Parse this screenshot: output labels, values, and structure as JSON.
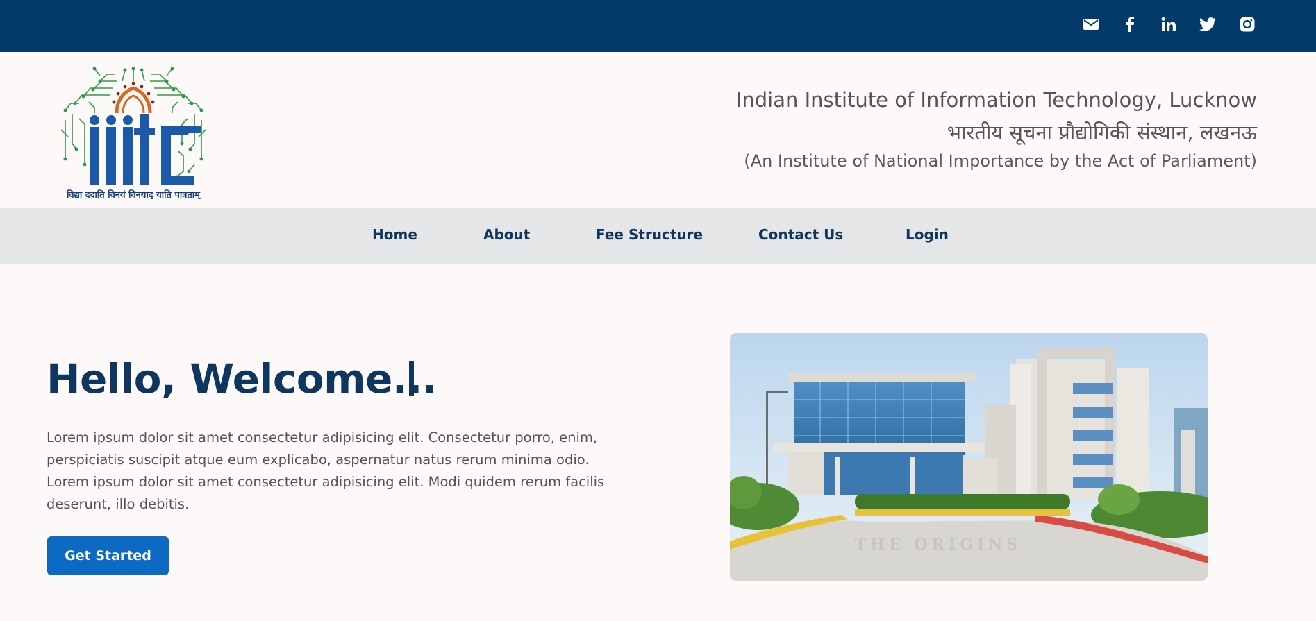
{
  "social_icons": [
    "mail-icon",
    "facebook-icon",
    "linkedin-icon",
    "twitter-icon",
    "instagram-icon"
  ],
  "header": {
    "logo_text": "iiitL",
    "logo_motto": "विद्या ददाति विनयं विनयाद् याति पात्रताम्",
    "title_en": "Indian Institute of Information Technology, Lucknow",
    "title_hi": "भारतीय सूचना प्रौद्योगिकी संस्थान, लखनऊ",
    "subtitle": "(An Institute of National Importance by the Act of Parliament)"
  },
  "nav": {
    "items": [
      "Home",
      "About",
      "Fee Structure",
      "Contact Us",
      "Login"
    ]
  },
  "hero": {
    "title": "Hello, Welcome...",
    "lines": [
      "Lorem ipsum dolor sit amet consectetur adipisicing elit. Consectetur porro, enim,",
      "perspiciatis suscipit atque eum explicabo, aspernatur natus rerum minima odio.",
      "Lorem ipsum dolor sit amet consectetur adipisicing elit. Modi quidem rerum facilis",
      "deserunt, illo debitis."
    ],
    "cta_label": "Get Started",
    "image_lettering": "THE ORIGINS"
  },
  "colors": {
    "topbar": "#023a69",
    "nav_bg": "#e5e6e7",
    "primary_text": "#0e365e",
    "button": "#0c6ac2",
    "page_bg": "#fdf9f8"
  }
}
